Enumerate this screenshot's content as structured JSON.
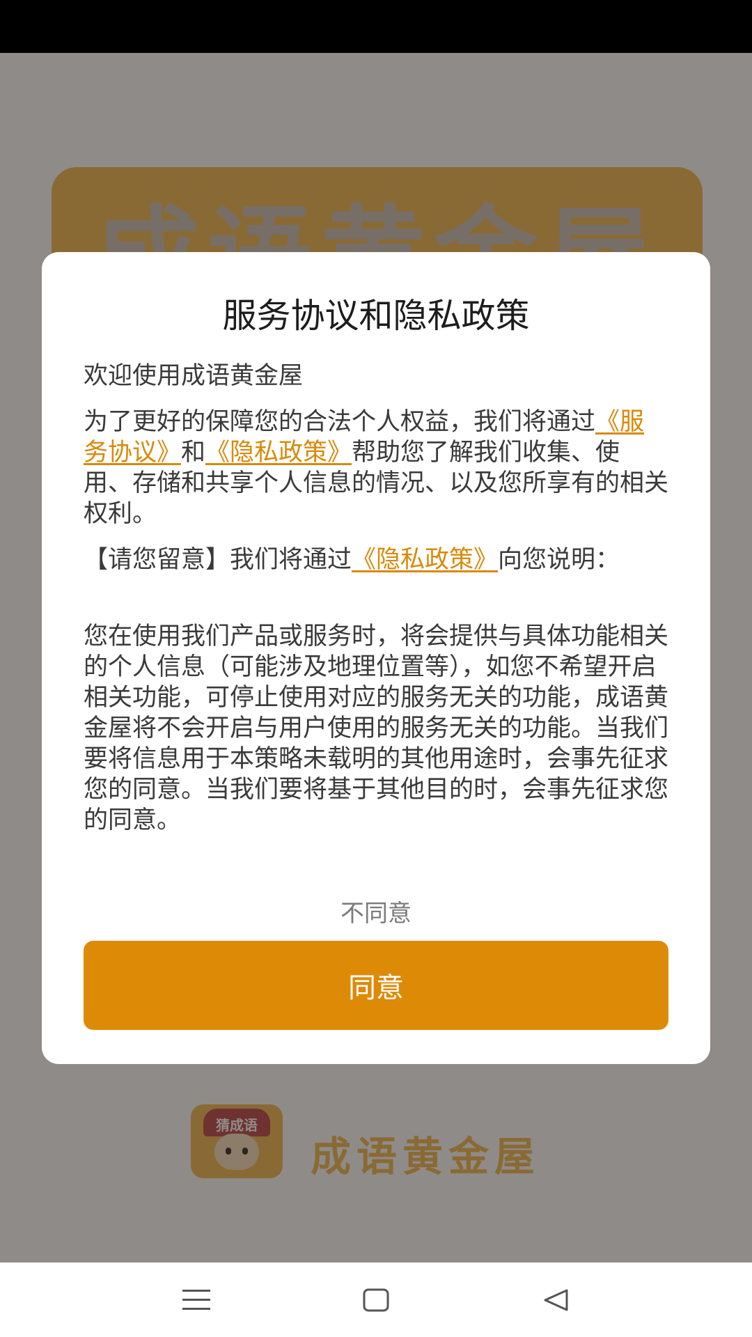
{
  "background": {
    "title": "成语黄金屋",
    "logo_badge": "猜成语",
    "app_name": "成语黄金屋"
  },
  "dialog": {
    "title": "服务协议和隐私政策",
    "welcome": "欢迎使用成语黄金屋",
    "intro_part1": "为了更好的保障您的合法个人权益，我们将通过",
    "link_service_agreement": "《服务协议》",
    "and": "和",
    "link_privacy_policy": "《隐私政策》",
    "intro_part2": "帮助您了解我们收集、使用、存储和共享个人信息的情况、以及您所享有的相关权利。",
    "notice_part1": "【请您留意】我们将通过",
    "link_privacy_policy_2": "《隐私政策》",
    "notice_part2": "向您说明：",
    "detail": "您在使用我们产品或服务时，将会提供与具体功能相关的个人信息（可能涉及地理位置等），如您不希望开启相关功能，可停止使用对应的服务无关的功能，成语黄金屋将不会开启与用户使用的服务无关的功能。当我们要将信息用于本策略未载明的其他用途时，会事先征求您的同意。当我们要将基于其他目的时，会事先征求您的同意。",
    "disagree_label": "不同意",
    "agree_label": "同意"
  },
  "colors": {
    "accent": "#dd8a06",
    "link": "#d9890a",
    "overlay_bg": "#8f8b89"
  },
  "icons": {
    "nav_menu": "menu-lines-icon",
    "nav_home": "square-home-icon",
    "nav_back": "triangle-back-icon"
  }
}
